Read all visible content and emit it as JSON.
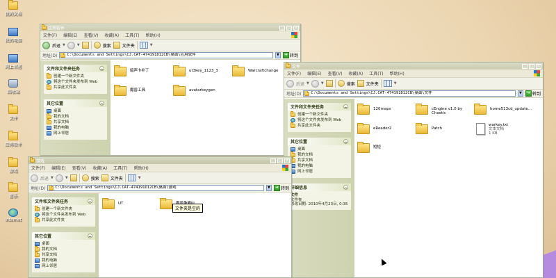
{
  "desktop": {
    "icons": [
      {
        "label": "我的文档",
        "icon": "folder-icon"
      },
      {
        "label": "我的电脑",
        "icon": "computer-icon"
      },
      {
        "label": "网上邻居",
        "icon": "network-icon"
      },
      {
        "label": "回收站",
        "icon": "recycle-bin-icon"
      },
      {
        "label": "文件",
        "icon": "folder-icon"
      },
      {
        "label": "应用软件",
        "icon": "folder-icon"
      },
      {
        "label": "游戏",
        "icon": "folder-icon"
      },
      {
        "label": "音乐",
        "icon": "folder-icon"
      },
      {
        "label": "Internet",
        "icon": "internet-icon"
      }
    ]
  },
  "menu": [
    "文件(F)",
    "编辑(E)",
    "查看(V)",
    "收藏(A)",
    "工具(T)",
    "帮助(H)"
  ],
  "toolbar": {
    "back": "后退",
    "search": "搜索",
    "folders": "文件夹"
  },
  "address_label": "地址(D)",
  "go_label": "转到",
  "window_apps": {
    "title": "应用软件",
    "address": "C:\\Documents and Settings\\CJ.CAT-474191D12CB\\桌面\\应用软件",
    "tasks_title": "文件和文件夹任务",
    "tasks": [
      "创建一个新文件夹",
      "将这个文件夹发布到 Web",
      "共享此文件夹"
    ],
    "places_title": "其它位置",
    "places": [
      "桌面",
      "我的文档",
      "共享文档",
      "我的电脑",
      "网上邻居"
    ],
    "files": [
      {
        "name": "暗声卡补丁",
        "type": "folder"
      },
      {
        "name": "ut3key_1123_3",
        "type": "folder"
      },
      {
        "name": "Warcraftchange",
        "type": "folder"
      },
      {
        "name": "魔兽工具",
        "type": "folder"
      },
      {
        "name": "avatarkeygen",
        "type": "folder"
      }
    ]
  },
  "window_files": {
    "title": "文件",
    "address": "C:\\Documents and Settings\\CJ.CAT-474191D12CB\\桌面\\文件",
    "tasks_title": "文件和文件夹任务",
    "tasks": [
      "创建一个新文件夹",
      "将这个文件夹发布到 Web",
      "共享此文件夹"
    ],
    "places_title": "其它位置",
    "places": [
      "桌面",
      "我的文档",
      "共享文档",
      "我的电脑",
      "网上邻居"
    ],
    "details_title": "详细信息",
    "details_name": "文件",
    "details_type": "文件夹",
    "details_modified": "修改日期: 2010年4月23日, 0:35",
    "files": [
      {
        "name": "120maps",
        "type": "folder"
      },
      {
        "name": "cEngine v1.0 by Chaotic",
        "type": "folder"
      },
      {
        "name": "home513cd_update...",
        "type": "folder"
      },
      {
        "name": "eReader2",
        "type": "folder"
      },
      {
        "name": "Patch",
        "type": "folder"
      },
      {
        "name": "warkey.txt",
        "type": "text",
        "sub1": "文本文档",
        "sub2": "1 KB"
      },
      {
        "name": "短短",
        "type": "folder"
      }
    ]
  },
  "window_games": {
    "title": "游戏",
    "address": "C:\\Documents and Settings\\CJ.CAT-474191D12CB\\桌面\\游戏",
    "tasks_title": "文件和文件夹任务",
    "tasks": [
      "创建一个新文件夹",
      "将这个文件夹发布到 Web",
      "共享此文件夹"
    ],
    "places_title": "其它位置",
    "places": [
      "桌面",
      "我的文档",
      "共享文档",
      "我的电脑",
      "网上邻居"
    ],
    "files": [
      {
        "name": "UT",
        "type": "folder"
      },
      {
        "name": "魔兽争霸III",
        "type": "folder"
      }
    ],
    "tooltip": "文件夹是空的"
  }
}
